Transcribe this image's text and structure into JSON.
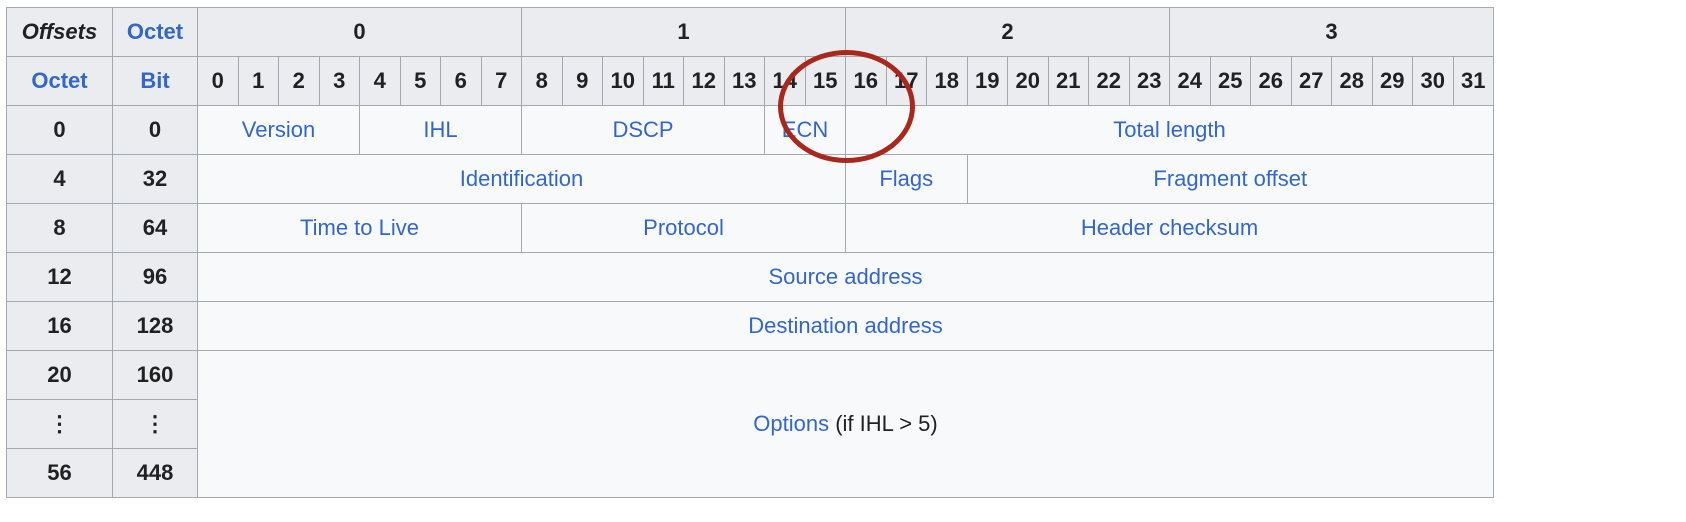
{
  "header": {
    "offsets_label": "Offsets",
    "octet_label": "Octet",
    "octet_row_label": "Octet",
    "bit_row_label": "Bit",
    "octets": [
      "0",
      "1",
      "2",
      "3"
    ],
    "bits": [
      "0",
      "1",
      "2",
      "3",
      "4",
      "5",
      "6",
      "7",
      "8",
      "9",
      "10",
      "11",
      "12",
      "13",
      "14",
      "15",
      "16",
      "17",
      "18",
      "19",
      "20",
      "21",
      "22",
      "23",
      "24",
      "25",
      "26",
      "27",
      "28",
      "29",
      "30",
      "31"
    ]
  },
  "rows": [
    {
      "octet": "0",
      "bit": "0"
    },
    {
      "octet": "4",
      "bit": "32"
    },
    {
      "octet": "8",
      "bit": "64"
    },
    {
      "octet": "12",
      "bit": "96"
    },
    {
      "octet": "16",
      "bit": "128"
    },
    {
      "octet": "20",
      "bit": "160"
    },
    {
      "octet": "⋮",
      "bit": "⋮"
    },
    {
      "octet": "56",
      "bit": "448"
    }
  ],
  "fields": {
    "version": "Version",
    "ihl": "IHL",
    "dscp": "DSCP",
    "ecn": "ECN",
    "total_length": "Total length",
    "identification": "Identification",
    "flags": "Flags",
    "fragment_offset": "Fragment offset",
    "ttl": "Time to Live",
    "protocol": "Protocol",
    "header_checksum": "Header checksum",
    "source_address": "Source address",
    "destination_address": "Destination address",
    "options": "Options",
    "options_note": "(if IHL > 5)"
  },
  "colors": {
    "link": "#3366cc",
    "header_bg": "#eaecf0",
    "cell_bg": "#f8f9fa",
    "border": "#a2a9b1",
    "highlight_circle": "#a8281e"
  }
}
